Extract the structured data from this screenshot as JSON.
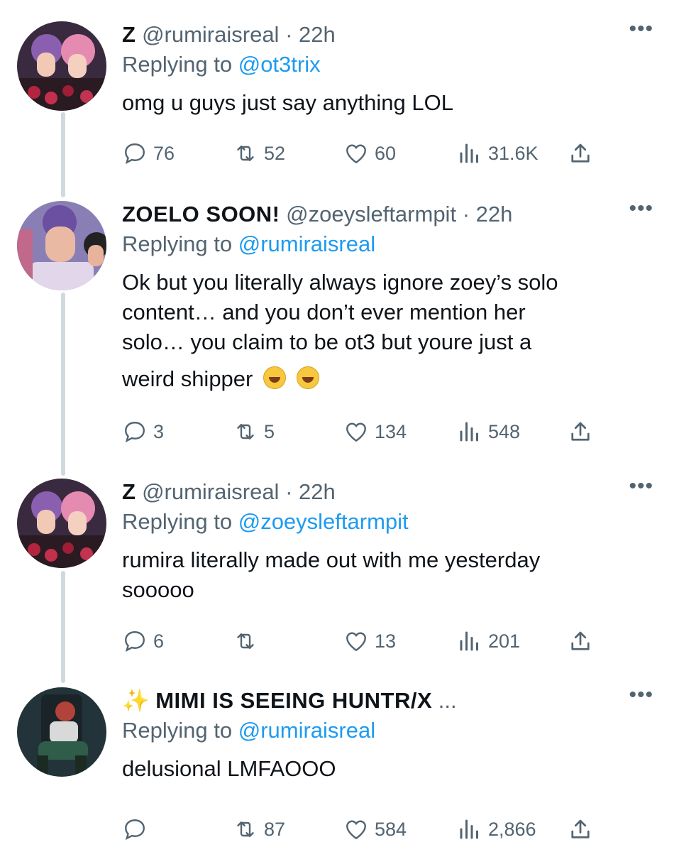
{
  "tweets": [
    {
      "name": "Z",
      "handle": "@rumiraisreal",
      "time": "22h",
      "replying_prefix": "Replying to",
      "replying_to": "@ot3trix",
      "text": "omg u guys just say anything LOL",
      "replies": "76",
      "retweets": "52",
      "likes": "60",
      "views": "31.6K"
    },
    {
      "name": "ZOELO SOON!",
      "handle": "@zoeysleftarmpit",
      "time": "22h",
      "replying_prefix": "Replying to",
      "replying_to": "@rumiraisreal",
      "text_lines": [
        "Ok but you literally always ignore zoey’s solo",
        "content… and you don’t ever mention her",
        "solo… you claim to be ot3 but youre just a",
        "weird shipper"
      ],
      "replies": "3",
      "retweets": "5",
      "likes": "134",
      "views": "548"
    },
    {
      "name": "Z",
      "handle": "@rumiraisreal",
      "time": "22h",
      "replying_prefix": "Replying to",
      "replying_to": "@zoeysleftarmpit",
      "text_lines": [
        "rumira literally made out with me yesterday",
        "sooooo"
      ],
      "replies": "6",
      "retweets": "",
      "likes": "13",
      "views": "201"
    },
    {
      "name": "MIMI IS SEEING HUNTR/X",
      "name_prefix": "✨",
      "name_suffix": "...",
      "replying_prefix": "Replying to",
      "replying_to": "@rumiraisreal",
      "text": "delusional LMFAOOO",
      "replies": "",
      "retweets": "87",
      "likes": "584",
      "views": "2,866"
    }
  ],
  "more_glyph": "•••",
  "icons": [
    "reply-icon",
    "retweet-icon",
    "like-icon",
    "views-icon",
    "share-icon",
    "more-icon"
  ],
  "colors": {
    "accent": "#1d9bf0",
    "secondary": "#536471",
    "thread_line": "#cfd9de"
  }
}
